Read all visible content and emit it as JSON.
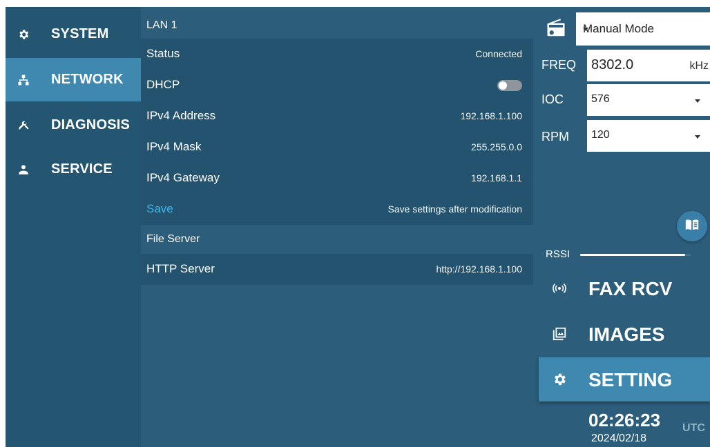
{
  "nav": {
    "items": [
      {
        "label": "SYSTEM",
        "icon": "gear-icon",
        "active": false
      },
      {
        "label": "NETWORK",
        "icon": "network-icon",
        "active": true
      },
      {
        "label": "DIAGNOSIS",
        "icon": "tools-icon",
        "active": false
      },
      {
        "label": "SERVICE",
        "icon": "person-icon",
        "active": false
      }
    ]
  },
  "lan": {
    "header": "LAN 1",
    "status_label": "Status",
    "status_value": "Connected",
    "dhcp_label": "DHCP",
    "dhcp_enabled": false,
    "ipv4_address_label": "IPv4 Address",
    "ipv4_address_value": "192.168.1.100",
    "ipv4_mask_label": "IPv4 Mask",
    "ipv4_mask_value": "255.255.0.0",
    "ipv4_gateway_label": "IPv4 Gateway",
    "ipv4_gateway_value": "192.168.1.1",
    "save_label": "Save",
    "save_hint": "Save settings after modification"
  },
  "file_server": {
    "header": "File Server",
    "http_label": "HTTP Server",
    "http_value": "http://192.168.1.100"
  },
  "right": {
    "mode_icon": "radio-icon",
    "mode_value": "Manual Mode",
    "freq_label": "FREQ",
    "freq_value": "8302.0",
    "freq_unit": "kHz",
    "ioc_label": "IOC",
    "ioc_value": "576",
    "rpm_label": "RPM",
    "rpm_value": "120",
    "book_icon": "book-icon",
    "rssi_label": "RSSI",
    "rssi_level": 0.95,
    "menu": [
      {
        "label": "FAX RCV",
        "icon": "broadcast-icon",
        "active": false
      },
      {
        "label": "IMAGES",
        "icon": "image-icon",
        "active": false
      },
      {
        "label": "SETTING",
        "icon": "gear-icon",
        "active": true
      }
    ],
    "time": "02:26:23",
    "timezone": "UTC",
    "date": "2024/02/18"
  },
  "colors": {
    "background": "#2c5d7a",
    "nav_background": "#245672",
    "row_background": "#23536e",
    "active": "#3f89b1",
    "link": "#3db7ef"
  }
}
